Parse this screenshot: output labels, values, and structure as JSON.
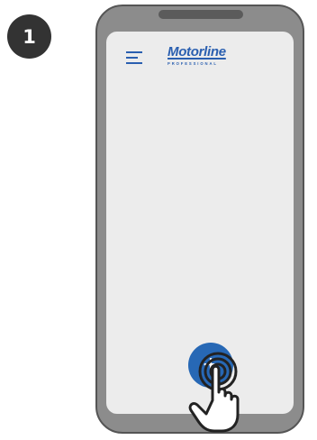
{
  "step": {
    "number": "1"
  },
  "brand": {
    "name": "Motorline",
    "tagline": "PROFESSIONAL"
  },
  "fab": {
    "symbol": "+"
  },
  "colors": {
    "brand": "#2a5fb0",
    "fab": "#2768b5",
    "phone_body": "#8c8c8c",
    "screen": "#ececec",
    "badge": "#333333"
  },
  "icons": {
    "menu": "hamburger-menu-icon",
    "gesture": "tap-hand-icon"
  }
}
